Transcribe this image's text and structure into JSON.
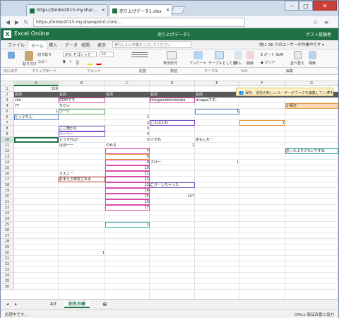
{
  "browser": {
    "tabs": [
      {
        "title": "https://tonbo2013-my.shar...",
        "active": false
      },
      {
        "title": "売り上げデータ1.xlsx",
        "active": true
      }
    ],
    "url": "https://tonbo2013-my.sharepoint.com/..."
  },
  "app": {
    "logo_text": "X",
    "name": "Excel Online",
    "doc_title": "売り上げデータ1",
    "guest": "ゲスト投稿者"
  },
  "menu": {
    "items": [
      "ファイル",
      "ホーム",
      "挿入",
      "データ",
      "校閲",
      "表示"
    ],
    "tell_me": "実行したい作業を入力してください",
    "editing_status": "他に 36 人のユーザーが作業中です ▾"
  },
  "ribbon": {
    "undo": "元に戻す",
    "paste": "貼り付け",
    "cut": "切り取り",
    "copy": "コピー",
    "font": "ＭＳ Ｐゴシック",
    "size": "11",
    "bold": "B",
    "italic": "I",
    "underline": "U",
    "number_format": "表示形式",
    "table_opts": "アンケート",
    "format_as_table": "テーブルとして書式設定",
    "insert": "挿入",
    "delete": "削除",
    "autosum": "オート SUM",
    "clear": "クリア",
    "sort": "並べ替え",
    "find": "検索"
  },
  "ribbon_groups": [
    "元に戻す",
    "クリップボード",
    "フォント",
    "配置",
    "数値",
    "テーブル",
    "セル",
    "編集"
  ],
  "grid": {
    "columns": [
      "A",
      "B",
      "C",
      "D",
      "E",
      "F",
      "G"
    ],
    "rows": [
      "1",
      "2",
      "3",
      "4",
      "5",
      "6",
      "7",
      "8",
      "9",
      "10",
      "11",
      "12",
      "13",
      "14",
      "15",
      "16",
      "17",
      "18",
      "19",
      "20",
      "21",
      "22",
      "23",
      "24",
      "25",
      "26",
      "27",
      "28",
      "29",
      "30",
      "31",
      "32",
      "33",
      "34",
      "35",
      "36"
    ],
    "cells": [
      {
        "text": "326"
      },
      {
        "text": "名前"
      },
      {
        "text": "名前"
      },
      {
        "text": "名前"
      },
      {
        "text": "名前"
      },
      {
        "text": "名前"
      },
      {
        "text": "名前"
      },
      {
        "text": "名前"
      },
      {
        "text": "sho"
      },
      {
        "text": "STAPです"
      },
      {
        "text": "hitugamdokimetata"
      },
      {
        "text": "ikiugaaです。"
      },
      {
        "text": "YT"
      },
      {
        "text": "ちだい"
      },
      {
        "text": "小保方"
      },
      {
        "text": "1"
      },
      {
        "text": "コージ"
      },
      {
        "text": "1"
      },
      {
        "text": "とっぷりん"
      },
      {
        "text": "1"
      },
      {
        "text": "2"
      },
      {
        "text": "こんばんわ"
      },
      {
        "text": "1"
      },
      {
        "text": "ここ暗から"
      },
      {
        "text": "3"
      },
      {
        "text": "へーへー"
      },
      {
        "text": "4"
      },
      {
        "text": "どうすれば？"
      },
      {
        "text": "5"
      },
      {
        "text": "けすね"
      },
      {
        "text": "あもしれー"
      },
      {
        "text": "ほほーー"
      },
      {
        "text": "やめろ"
      },
      {
        "text": "1"
      },
      {
        "text": "7"
      },
      {
        "text": "思ったより少ないですね"
      },
      {
        "text": "8"
      },
      {
        "text": "9"
      },
      {
        "text": "すげー"
      },
      {
        "text": "1"
      },
      {
        "text": "10"
      },
      {
        "text": "ええこー"
      },
      {
        "text": "11"
      },
      {
        "text": "おまえら特定される"
      },
      {
        "text": "12"
      },
      {
        "text": "13"
      },
      {
        "text": "こびーしちゃった"
      },
      {
        "text": "14"
      },
      {
        "text": "15"
      },
      {
        "text": "147"
      },
      {
        "text": "16"
      },
      {
        "text": "17"
      },
      {
        "text": "1"
      },
      {
        "text": "1"
      }
    ]
  },
  "notice": "保存、通信の新しいユーザーがブックを編集しています",
  "sheet_tabs": [
    "Art",
    "記名台帳"
  ],
  "status": {
    "left": "処理中です...",
    "right": "Office 製品改善に協力"
  },
  "colors": {
    "excel_green": "#1e7145",
    "header_dark": "#595959",
    "notice_bg": "#fff2c6"
  }
}
